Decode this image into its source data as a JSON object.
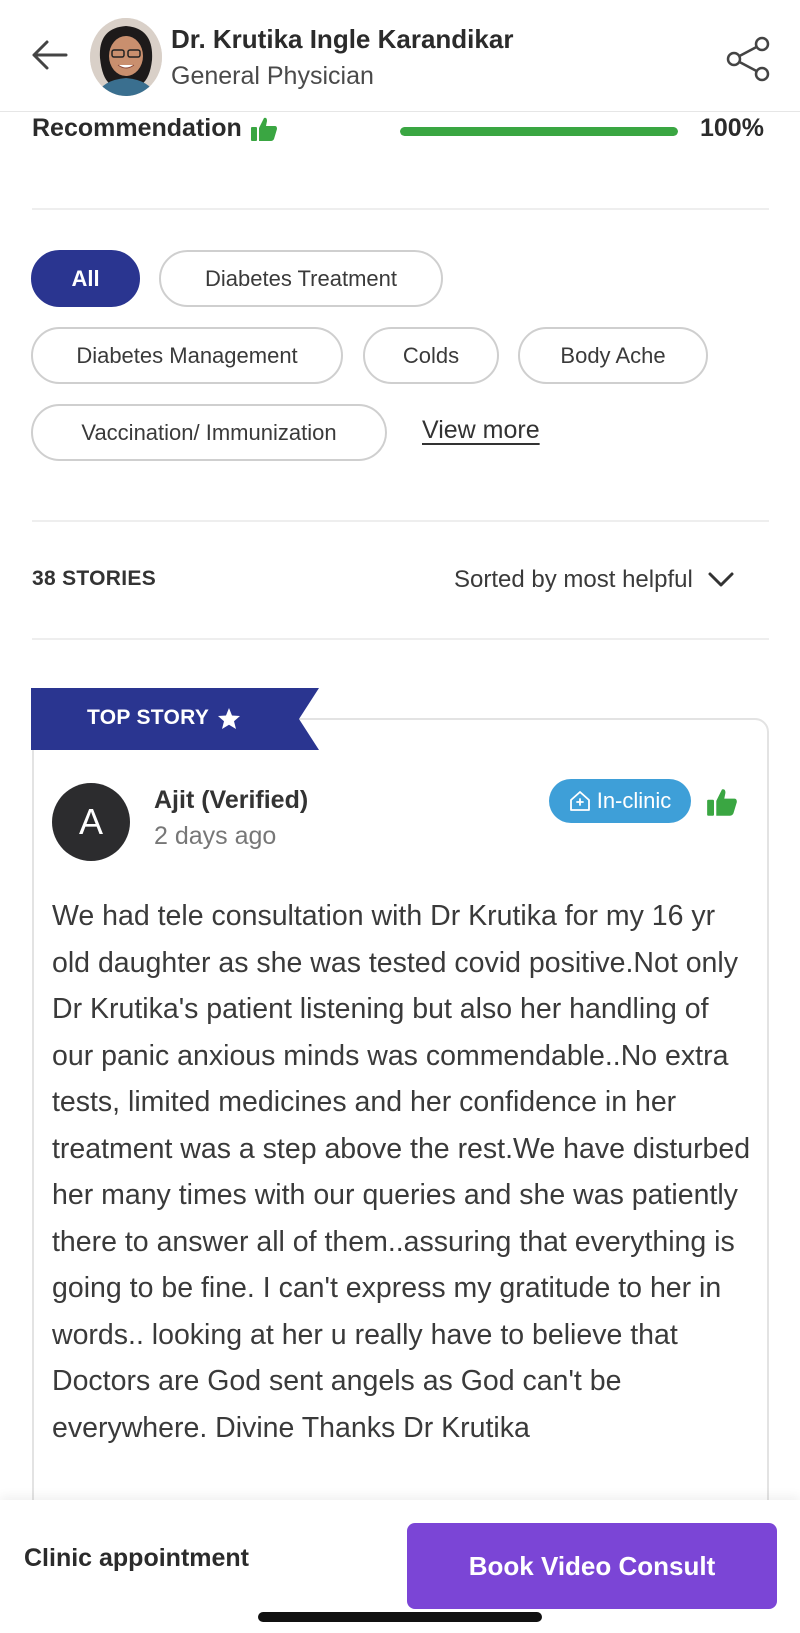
{
  "header": {
    "doctor_name": "Dr. Krutika Ingle Karandikar",
    "specialty": "General Physician",
    "icons": {
      "back": "arrow-left-icon",
      "share": "share-icon"
    }
  },
  "recommendation": {
    "label": "Recommendation",
    "percent_text": "100%",
    "percent_value": 100,
    "color": "#3aa642"
  },
  "filters": {
    "chips": [
      {
        "label": "All",
        "active": true
      },
      {
        "label": "Diabetes Treatment",
        "active": false
      },
      {
        "label": "Diabetes Management",
        "active": false
      },
      {
        "label": "Colds",
        "active": false
      },
      {
        "label": "Body Ache",
        "active": false
      },
      {
        "label": "Vaccination/ Immunization",
        "active": false
      }
    ],
    "view_more": "View more",
    "active_color": "#2a3590"
  },
  "stories": {
    "count_label": "38 STORIES",
    "sort_label": "Sorted by most helpful"
  },
  "top_story": {
    "ribbon_label": "TOP STORY",
    "avatar_letter": "A",
    "user_name": "Ajit (Verified)",
    "time": "2 days ago",
    "badge": "In-clinic",
    "badge_color": "#3e9fd8",
    "text": "We had tele consultation with Dr Krutika for my 16 yr old daughter as she was tested covid positive.Not only Dr Krutika's patient listening but also her handling of our panic anxious minds was commendable..No extra tests, limited medicines and her confidence in her treatment was a step above the rest.We have disturbed her many times with our queries and she was patiently there to answer all of them..assuring that everything is going to be fine. I can't express my gratitude to her in words.. looking at her u really have to believe that Doctors are God sent angels as God can't be everywhere. Divine Thanks Dr Krutika"
  },
  "bottom_bar": {
    "clinic_label": "Clinic appointment",
    "video_label": "Book Video Consult",
    "video_color": "#7b45d6"
  }
}
